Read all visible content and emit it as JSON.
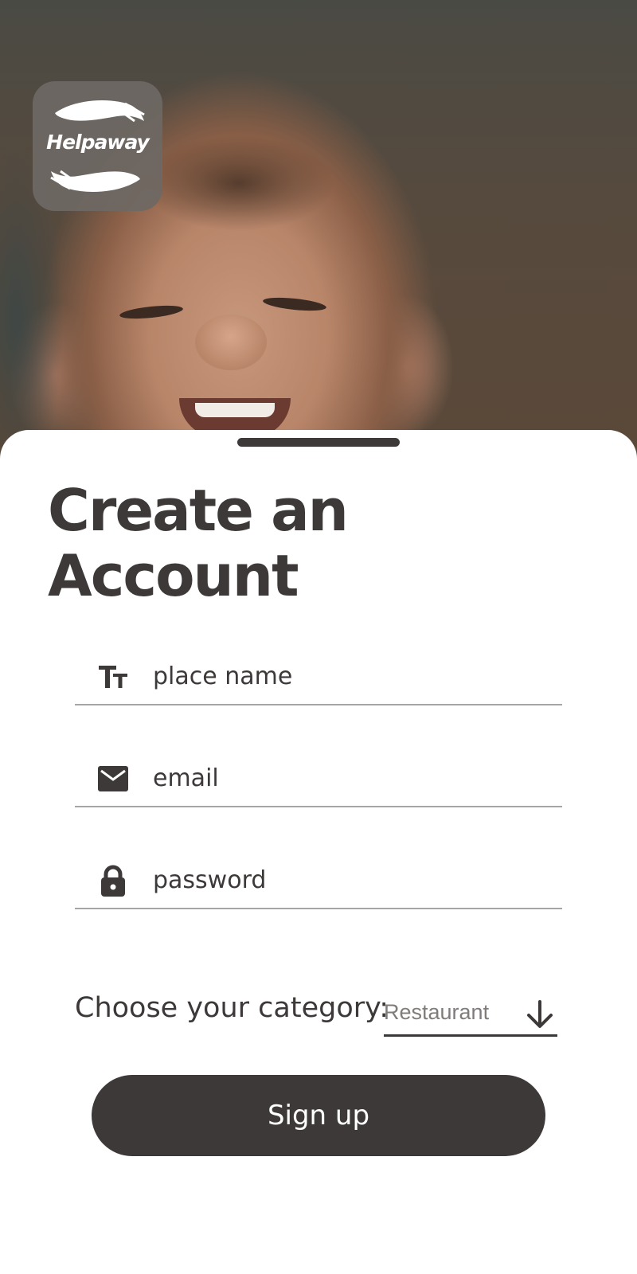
{
  "app": {
    "logo_text": "Helpaway"
  },
  "form": {
    "title_line1": "Create an",
    "title_line2": "Account",
    "fields": [
      {
        "icon": "text-size-icon",
        "placeholder": "place name"
      },
      {
        "icon": "mail-icon",
        "placeholder": "email"
      },
      {
        "icon": "lock-icon",
        "placeholder": "password"
      }
    ],
    "category_label": "Choose your category:",
    "category_value": "Restaurant",
    "category_icon": "arrow-down-icon",
    "submit_label": "Sign up"
  },
  "colors": {
    "primary": "#3d3938",
    "divider": "#a8a6a5",
    "muted_text": "#807c7a",
    "logo_tile": "#6e6864"
  }
}
